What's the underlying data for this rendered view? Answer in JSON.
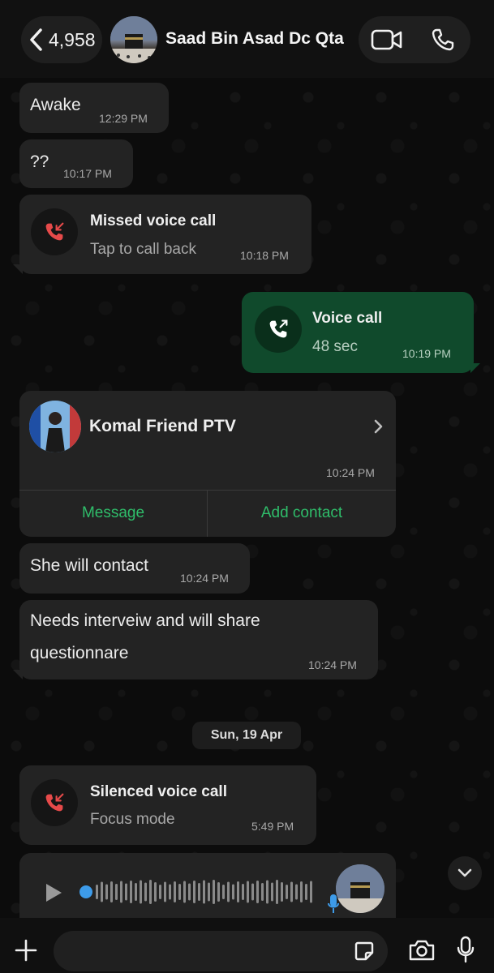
{
  "header": {
    "back_count": "4,958",
    "contact_name": "Saad Bin Asad Dc Qta",
    "icons": [
      "chevron-left-icon",
      "video-call-icon",
      "voice-call-icon"
    ]
  },
  "messages": {
    "m1": {
      "text": "Awake",
      "time": "12:29 PM"
    },
    "m2": {
      "text": "??",
      "time": "10:17 PM"
    },
    "m3": {
      "title": "Missed voice call",
      "subtitle": "Tap to call back",
      "time": "10:18 PM"
    },
    "m4": {
      "title": "Voice call",
      "subtitle": "48 sec",
      "time": "10:19 PM"
    },
    "m5": {
      "name": "Komal Friend PTV",
      "time": "10:24 PM",
      "message_label": "Message",
      "add_label": "Add contact"
    },
    "m6": {
      "text": "She will contact",
      "time": "10:24 PM"
    },
    "m7": {
      "line1": "Needs interveiw and will share",
      "line2": "questionnare",
      "time": "10:24 PM"
    },
    "date_divider": "Sun, 19 Apr",
    "m8": {
      "title": "Silenced voice call",
      "subtitle": "Focus mode",
      "time": "5:49 PM"
    }
  },
  "colors": {
    "accent_green": "#2fbd6a",
    "outgoing_bubble": "#104a2c",
    "incoming_bubble": "#232323",
    "missed_red": "#e64a4a"
  },
  "bottom_bar": {
    "icons": [
      "plus-icon",
      "sticker-icon",
      "camera-icon",
      "microphone-icon"
    ]
  }
}
